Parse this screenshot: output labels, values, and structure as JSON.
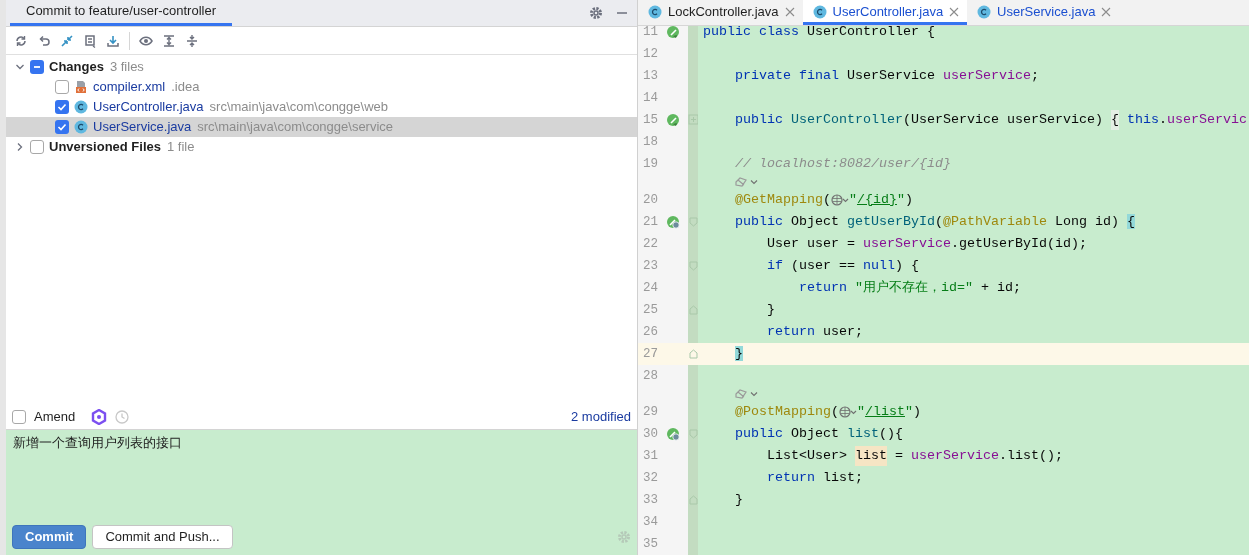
{
  "commit_panel": {
    "title": "Commit to feature/user-controller",
    "tree": [
      {
        "label": "Changes",
        "count": "3 files",
        "kind": "group",
        "expanded": true,
        "checked": true,
        "partial": true,
        "selected": false,
        "children": [
          {
            "label": "compiler.xml",
            "path": ".idea",
            "kind": "xml",
            "checked": false,
            "selected": false
          },
          {
            "label": "UserController.java",
            "path": "src\\main\\java\\com\\congge\\web",
            "kind": "class",
            "checked": true,
            "selected": false
          },
          {
            "label": "UserService.java",
            "path": "src\\main\\java\\com\\congge\\service",
            "kind": "class",
            "checked": true,
            "selected": true
          }
        ]
      },
      {
        "label": "Unversioned Files",
        "count": "1 file",
        "kind": "group",
        "expanded": false,
        "checked": false,
        "selected": false
      }
    ],
    "amend": {
      "label": "Amend",
      "checked": false
    },
    "modified_link": "2 modified",
    "message": "新增一个查询用户列表的接口",
    "buttons": [
      {
        "label": "Commit",
        "primary": true
      },
      {
        "label": "Commit and Push...",
        "primary": false
      }
    ]
  },
  "editor": {
    "tabs": [
      {
        "label": "LockController.java",
        "selected": false,
        "modified": false
      },
      {
        "label": "UserController.java",
        "selected": true,
        "modified": true
      },
      {
        "label": "UserService.java",
        "selected": false,
        "modified": true
      }
    ],
    "lines": [
      {
        "kind": "code",
        "number": "11",
        "gutter": {
          "kind": "bean-run"
        },
        "current": false,
        "tokens": [
          {
            "kind": "kw",
            "text": "public class"
          },
          {
            "kind": "plain",
            "text": " UserController {"
          }
        ]
      },
      {
        "kind": "code",
        "number": "12",
        "current": false
      },
      {
        "kind": "code",
        "number": "13",
        "current": false,
        "tokens": [
          {
            "kind": "kw",
            "text": "    private final"
          },
          {
            "kind": "plain",
            "text": " UserService "
          },
          {
            "kind": "field",
            "text": "userService"
          },
          {
            "kind": "plain",
            "text": ";"
          }
        ]
      },
      {
        "kind": "code",
        "number": "14",
        "current": false
      },
      {
        "kind": "code",
        "number": "15",
        "gutter": {
          "kind": "bean-run"
        },
        "fold": {
          "kind": "collapsed"
        },
        "current": false,
        "tokens": [
          {
            "kind": "kw",
            "text": "    public"
          },
          {
            "kind": "fn",
            "text": " UserController"
          },
          {
            "kind": "plain",
            "text": "(UserService userService) "
          },
          {
            "kind": "folded",
            "text": "{"
          },
          {
            "kind": "kw",
            "text": " this"
          },
          {
            "kind": "plain",
            "text": "."
          },
          {
            "kind": "field",
            "text": "userServic"
          }
        ]
      },
      {
        "kind": "code",
        "number": "18",
        "current": false
      },
      {
        "kind": "code",
        "number": "19",
        "current": false,
        "tokens": [
          {
            "kind": "comment",
            "text": "    // localhost:8082/user/{id}"
          }
        ]
      },
      {
        "kind": "hint"
      },
      {
        "kind": "code",
        "number": "20",
        "current": false,
        "tokens": [
          {
            "kind": "ann",
            "text": "    @GetMapping"
          },
          {
            "kind": "plain",
            "text": "("
          },
          {
            "kind": "globe"
          },
          {
            "kind": "str",
            "text": "\""
          },
          {
            "kind": "link",
            "text": "/{id}"
          },
          {
            "kind": "str",
            "text": "\""
          },
          {
            "kind": "plain",
            "text": ")"
          }
        ]
      },
      {
        "kind": "code",
        "number": "21",
        "gutter": {
          "kind": "bean-web"
        },
        "fold": {
          "kind": "start"
        },
        "current": false,
        "tokens": [
          {
            "kind": "kw",
            "text": "    public"
          },
          {
            "kind": "plain",
            "text": " Object"
          },
          {
            "kind": "fn",
            "text": " getUserById"
          },
          {
            "kind": "plain",
            "text": "("
          },
          {
            "kind": "ann",
            "text": "@PathVariable"
          },
          {
            "kind": "plain",
            "text": " Long id) "
          },
          {
            "kind": "brace",
            "text": "{"
          }
        ]
      },
      {
        "kind": "code",
        "number": "22",
        "current": false,
        "tokens": [
          {
            "kind": "plain",
            "text": "        User user = "
          },
          {
            "kind": "field",
            "text": "userService"
          },
          {
            "kind": "plain",
            "text": ".getUserById(id);"
          }
        ]
      },
      {
        "kind": "code",
        "number": "23",
        "fold": {
          "kind": "start"
        },
        "current": false,
        "tokens": [
          {
            "kind": "kw",
            "text": "        if"
          },
          {
            "kind": "plain",
            "text": " (user == "
          },
          {
            "kind": "kw",
            "text": "null"
          },
          {
            "kind": "plain",
            "text": ") {"
          }
        ]
      },
      {
        "kind": "code",
        "number": "24",
        "current": false,
        "tokens": [
          {
            "kind": "kw",
            "text": "            return"
          },
          {
            "kind": "str",
            "text": " \"用户不存在，id=\""
          },
          {
            "kind": "plain",
            "text": " + id;"
          }
        ]
      },
      {
        "kind": "code",
        "number": "25",
        "fold": {
          "kind": "end"
        },
        "current": false,
        "tokens": [
          {
            "kind": "plain",
            "text": "        }"
          }
        ]
      },
      {
        "kind": "code",
        "number": "26",
        "current": false,
        "tokens": [
          {
            "kind": "kw",
            "text": "        return"
          },
          {
            "kind": "plain",
            "text": " user;"
          }
        ]
      },
      {
        "kind": "code",
        "number": "27",
        "fold": {
          "kind": "end"
        },
        "current": true,
        "tokens": [
          {
            "kind": "brace",
            "text": "    }"
          }
        ]
      },
      {
        "kind": "code",
        "number": "28",
        "current": false
      },
      {
        "kind": "hint"
      },
      {
        "kind": "code",
        "number": "29",
        "current": false,
        "tokens": [
          {
            "kind": "ann",
            "text": "    @PostMapping"
          },
          {
            "kind": "plain",
            "text": "("
          },
          {
            "kind": "globe"
          },
          {
            "kind": "str",
            "text": "\""
          },
          {
            "kind": "link",
            "text": "/list"
          },
          {
            "kind": "str",
            "text": "\""
          },
          {
            "kind": "plain",
            "text": ")"
          }
        ]
      },
      {
        "kind": "code",
        "number": "30",
        "gutter": {
          "kind": "bean-web"
        },
        "fold": {
          "kind": "start"
        },
        "current": false,
        "tokens": [
          {
            "kind": "kw",
            "text": "    public"
          },
          {
            "kind": "plain",
            "text": " Object"
          },
          {
            "kind": "fn",
            "text": " list"
          },
          {
            "kind": "plain",
            "text": "(){"
          }
        ]
      },
      {
        "kind": "code",
        "number": "31",
        "current": false,
        "tokens": [
          {
            "kind": "plain",
            "text": "        List<User> "
          },
          {
            "kind": "usage",
            "text": "list"
          },
          {
            "kind": "plain",
            "text": " = "
          },
          {
            "kind": "field",
            "text": "userService"
          },
          {
            "kind": "plain",
            "text": ".list();"
          }
        ]
      },
      {
        "kind": "code",
        "number": "32",
        "current": false,
        "tokens": [
          {
            "kind": "kw",
            "text": "        return"
          },
          {
            "kind": "plain",
            "text": " list;"
          }
        ]
      },
      {
        "kind": "code",
        "number": "33",
        "fold": {
          "kind": "end"
        },
        "current": false,
        "tokens": [
          {
            "kind": "plain",
            "text": "    }"
          }
        ]
      },
      {
        "kind": "code",
        "number": "34",
        "current": false
      },
      {
        "kind": "code",
        "number": "35",
        "current": false
      }
    ]
  }
}
